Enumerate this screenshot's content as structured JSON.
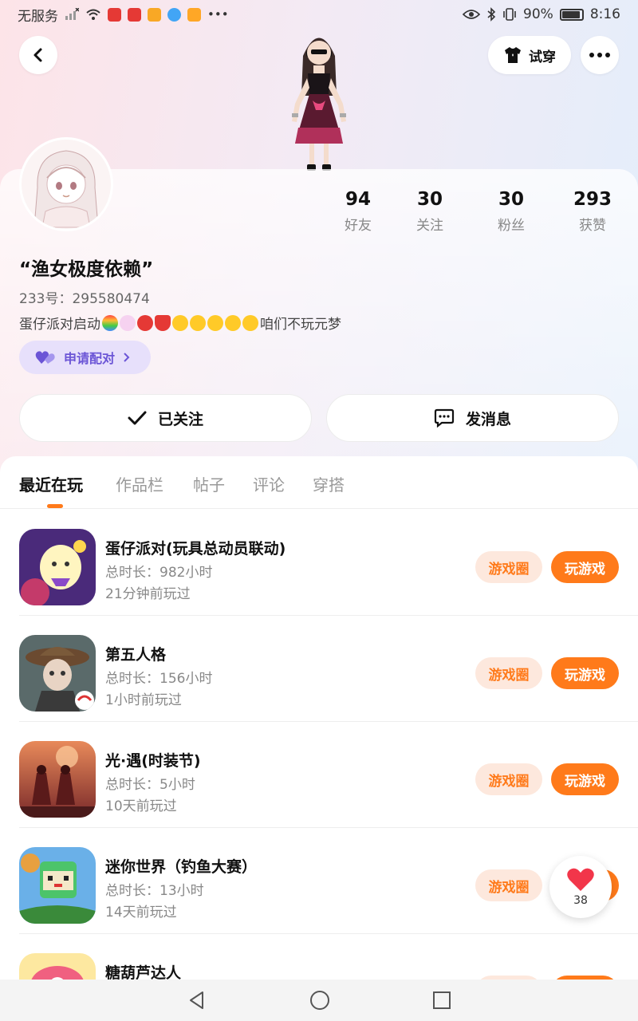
{
  "status_bar": {
    "carrier": "无服务",
    "battery": "90%",
    "time": "8:16",
    "battery_level": 0.9,
    "icons": [
      "signal-x-icon",
      "wifi-icon",
      "eye-icon",
      "bluetooth-icon",
      "vibrate-icon",
      "more-dots-icon"
    ]
  },
  "header": {
    "tryon_label": "试穿",
    "back_icon": "back-chevron-icon",
    "more_icon": "more-icon"
  },
  "profile": {
    "nickname": "“渔女极度依赖”",
    "user_id": "233号：295580474",
    "bio_prefix": "蛋仔派对启动",
    "bio_suffix": "咱们不玩元梦",
    "pair_label": "申请配对",
    "stats": [
      {
        "num": "94",
        "label": "好友"
      },
      {
        "num": "30",
        "label": "关注"
      },
      {
        "num": "30",
        "label": "粉丝"
      },
      {
        "num": "293",
        "label": "获赞"
      }
    ]
  },
  "actions": {
    "follow_label": "已关注",
    "message_label": "发消息"
  },
  "tabs": [
    "最近在玩",
    "作品栏",
    "帖子",
    "评论",
    "穿搭"
  ],
  "games": [
    {
      "title": "蛋仔派对(玩具总动员联动)",
      "duration": "总时长：982小时",
      "last": "21分钟前玩过"
    },
    {
      "title": "第五人格",
      "duration": "总时长：156小时",
      "last": "1小时前玩过"
    },
    {
      "title": "光·遇(时装节)",
      "duration": "总时长：5小时",
      "last": "10天前玩过"
    },
    {
      "title": "迷你世界（钓鱼大赛）",
      "duration": "总时长：13小时",
      "last": "14天前玩过"
    },
    {
      "title": "糖葫芦达人",
      "duration": "",
      "last": ""
    }
  ],
  "game_buttons": {
    "circle": "游戏圈",
    "play": "玩游戏"
  },
  "like_float": {
    "count": "38"
  },
  "colors": {
    "accent": "#ff7a1a",
    "pair": "#6b55d6"
  }
}
